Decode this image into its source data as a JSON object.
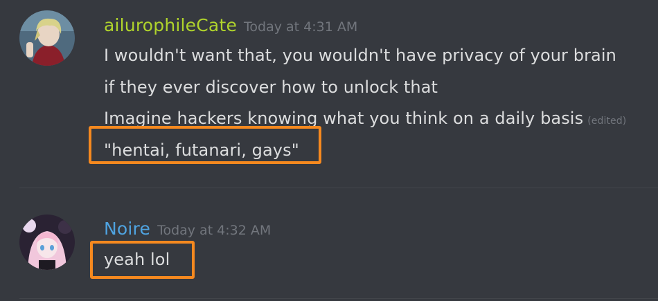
{
  "messages": [
    {
      "username": "ailurophileCate",
      "timestamp": "Today at 4:31 AM",
      "avatar_icon": "avatar-anime-blonde-icon",
      "lines": [
        "I wouldn't want that, you wouldn't have privacy of your brain",
        "if they ever discover how to unlock that",
        "Imagine hackers knowing what you think on a daily basis",
        "\"hentai, futanari, gays\""
      ],
      "edited_label": "(edited)"
    },
    {
      "username": "Noire",
      "timestamp": "Today at 4:32 AM",
      "avatar_icon": "avatar-anime-pink-hair-icon",
      "lines": [
        "yeah lol"
      ]
    }
  ],
  "colors": {
    "background": "#36393f",
    "username_1": "#b0d42c",
    "username_2": "#4fa3e0",
    "message_text": "#dcddde",
    "timestamp": "#72767d",
    "highlight": "#f6891f"
  }
}
